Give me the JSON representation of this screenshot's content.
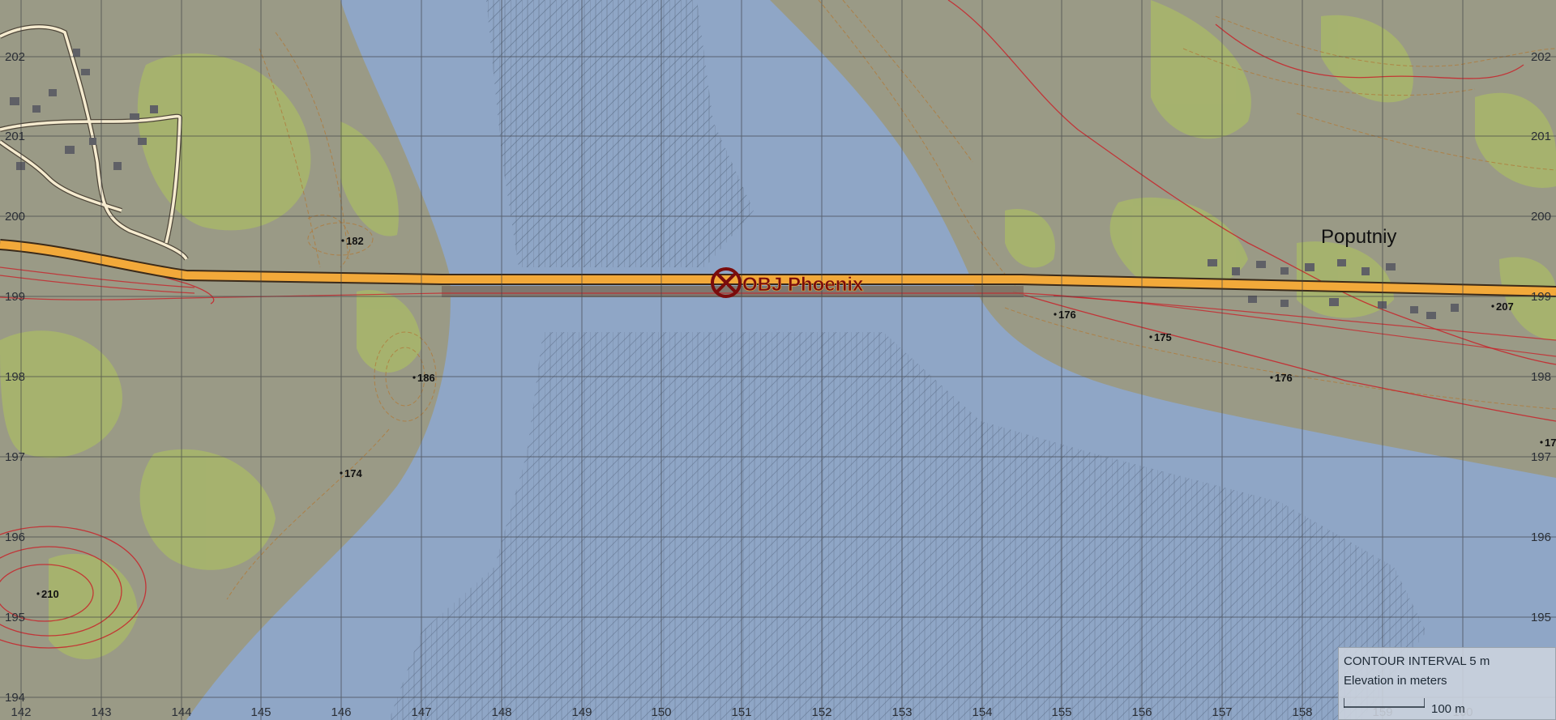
{
  "map": {
    "grid": {
      "easting_labels": [
        "142",
        "143",
        "144",
        "145",
        "146",
        "147",
        "148",
        "149",
        "150",
        "151",
        "152",
        "153",
        "154",
        "155",
        "156",
        "157",
        "158",
        "159",
        "160"
      ],
      "northing_labels": [
        "202",
        "201",
        "200",
        "199",
        "198",
        "197",
        "196",
        "195",
        "194"
      ]
    },
    "spot_heights": [
      "182",
      "186",
      "174",
      "210",
      "176",
      "175",
      "176",
      "207",
      "17"
    ],
    "town_name": "Poputniy",
    "objective": {
      "label": "OBJ Phoenix",
      "icon": "crossed-circle-objective-icon",
      "color": "#7a0c0c"
    },
    "colors": {
      "water": "#8fa6c6",
      "land": "#9a9a86",
      "forest": "#a7b56c",
      "road_main": "#f2a93a",
      "contour": "#b07a3a",
      "contour_index": "#c8232a",
      "grid": "#3c3f44"
    }
  },
  "legend": {
    "contour_interval": "CONTOUR INTERVAL 5 m",
    "elevation_note": "Elevation in meters",
    "scale_label": "100 m"
  }
}
